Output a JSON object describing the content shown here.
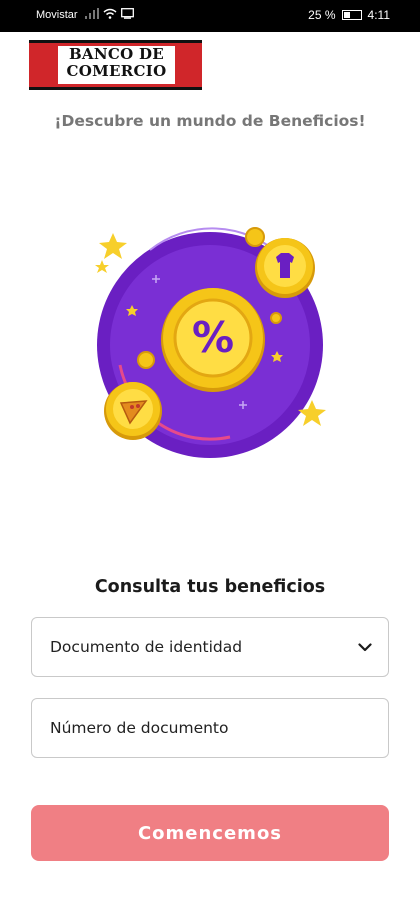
{
  "status_bar": {
    "carrier": "Movistar",
    "battery": "25 %",
    "time": "4:11"
  },
  "brand": {
    "line1": "BANCO DE",
    "line2": "COMERCIO",
    "color": "#d0262a"
  },
  "tagline": "¡Descubre un mundo de Beneficios!",
  "hero": {
    "badge_symbol": "%",
    "colors": {
      "circle": "#6a1fc2",
      "coin": "#f5c518",
      "star": "#f7cf2b"
    }
  },
  "form": {
    "title": "Consulta tus beneficios",
    "document_type": {
      "value": "Documento de identidad",
      "icon": "chevron-down-icon"
    },
    "document_number": {
      "placeholder": "Número de documento",
      "value": ""
    },
    "submit_label": "Comencemos",
    "submit_color": "#f07f84"
  }
}
